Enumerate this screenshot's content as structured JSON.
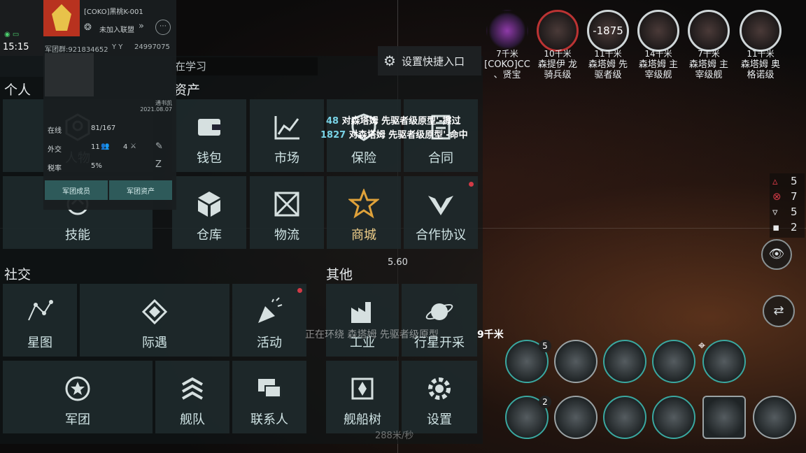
{
  "status": {
    "time": "15:15"
  },
  "corp_panel": {
    "tag": "[COKO]黑桃K-001",
    "alliance": "未加入联盟",
    "group_id": "军团群:921834652",
    "coord_label": "Y  Y",
    "coord_value": "24997075",
    "ceo": "通书凯",
    "date": "2021.08.07",
    "online_label": "在线",
    "online_value": "81/167",
    "diplo_label": "外交",
    "diplo_a": "11",
    "diplo_b": "4",
    "tax_label": "税率",
    "tax_value": "5%",
    "members_btn": "军团成员",
    "assets_btn": "军团资产"
  },
  "quick_entry": "设置快捷入口",
  "learning_header": "在学习",
  "sections": {
    "personal": "个人",
    "assets": "资产",
    "social": "社交",
    "other": "其他"
  },
  "tiles": {
    "character": "人物",
    "skills": "技能",
    "wallet": "钱包",
    "market": "市场",
    "insurance": "保险",
    "contracts": "合同",
    "warehouse": "仓库",
    "logistics": "物流",
    "shop": "商城",
    "cooperation": "合作协议",
    "starmap": "星图",
    "encounter": "际遇",
    "events": "活动",
    "corporation": "军团",
    "fleet": "舰队",
    "contacts": "联系人",
    "industry": "工业",
    "planet_mining": "行星开采",
    "ship_tree": "舰船树",
    "settings": "设置"
  },
  "combat_log": [
    {
      "num": "48",
      "text": "对森塔姆 先驱者级原型'-擦过"
    },
    {
      "num": "1827",
      "text": "对森塔姆 先驱者级原型'-命中"
    }
  ],
  "warp_text": "正在环绕 森塔姆 先驱者级原型",
  "warp_distance": "9千米",
  "speed_value": "5.60",
  "speed_label": "288米/秒",
  "targets": [
    {
      "dist": "7千米",
      "name": "[COKO]CC\n、贤宝",
      "damage": ""
    },
    {
      "dist": "10千米",
      "name": "森提伊 龙\n骑兵级",
      "damage": ""
    },
    {
      "dist": "11千米",
      "name": "森塔姆 先\n驱者级",
      "damage": "-1875"
    },
    {
      "dist": "14千米",
      "name": "森塔姆 主\n宰级舰",
      "damage": ""
    },
    {
      "dist": "7千米",
      "name": "森塔姆 主\n宰级舰",
      "damage": ""
    },
    {
      "dist": "11千米",
      "name": "森塔姆 奥\n格诺级",
      "damage": ""
    }
  ],
  "side_counts": {
    "red": "5",
    "target": "7",
    "drone": "5",
    "cargo": "2"
  },
  "module_counts": {
    "top": "5",
    "bottom": "2"
  },
  "colors": {
    "accent": "#3aa8a0",
    "alert": "#d23a46",
    "shop": "#e0a23a"
  }
}
